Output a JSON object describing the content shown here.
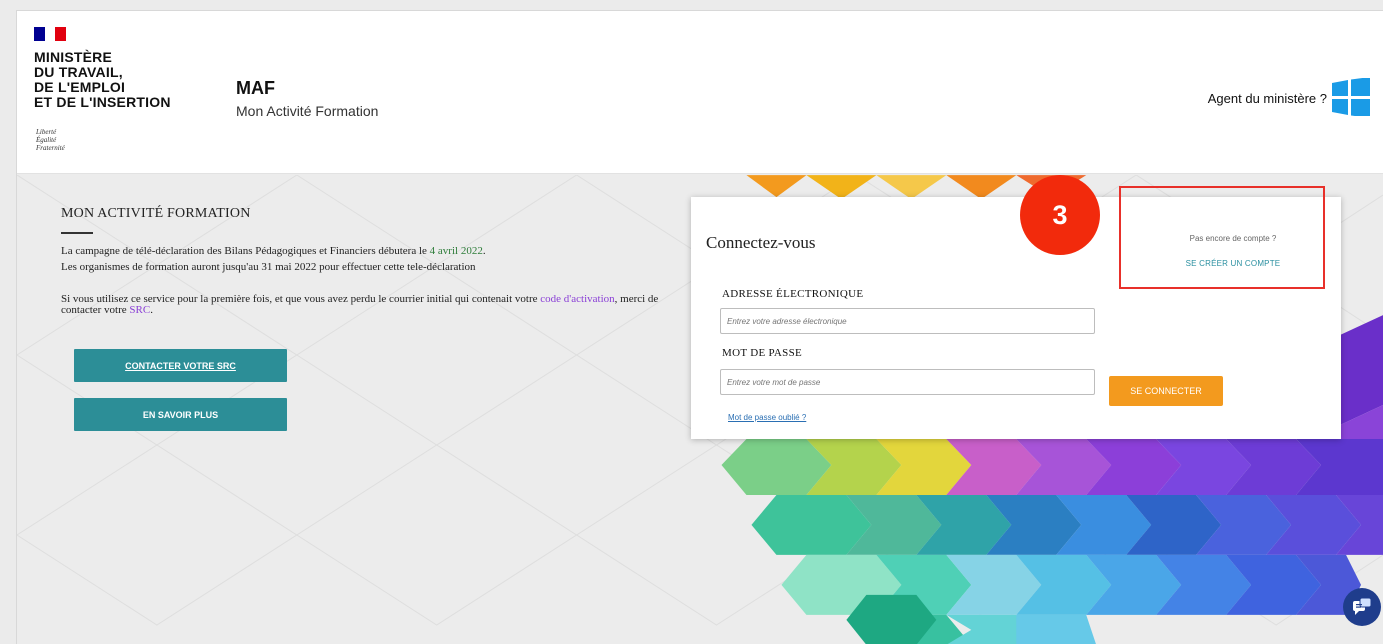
{
  "colors": {
    "flag_blue": "#000091",
    "flag_white": "#ffffff",
    "flag_red": "#e1000f",
    "teal_button": "#2c8e97",
    "orange_button": "#f39a1e",
    "annotation_red": "#f22a0c",
    "link_blue": "#2a6fb3",
    "windows_blue": "#1a9be6",
    "chat_blue": "#1f3d8c"
  },
  "header": {
    "ministry_lines": [
      "MINISTÈRE",
      "DU TRAVAIL,",
      "DE L'EMPLOI",
      "ET DE L'INSERTION"
    ],
    "motto_lines": [
      "Liberté",
      "Égalité",
      "Fraternité"
    ],
    "app_title": "MAF",
    "app_subtitle": "Mon Activité Formation",
    "agent_link": "Agent du ministère ?",
    "agent_icon": "windows-icon"
  },
  "left": {
    "heading": "MON ACTIVITÉ FORMATION",
    "para1_a": "La campagne de télé-déclaration des Bilans Pédagogiques et Financiers débutera le ",
    "para1_date": "4 avril 2022",
    "para1_end": ".",
    "para2": "Les organismes de formation auront jusqu'au 31 mai 2022 pour effectuer cette tele-déclaration",
    "para3_a": "Si vous utilisez ce service pour la première fois, et que vous avez perdu le courrier initial qui contenait votre ",
    "para3_link": "code d'activation",
    "para3_b": ", merci de contacter votre ",
    "para3_src": "SRC",
    "para3_end": ".",
    "contact_button": "CONTACTER VOTRE SRC",
    "more_button": "EN SAVOIR PLUS"
  },
  "login": {
    "title": "Connectez-vous",
    "email_label": "ADRESSE ÉLECTRONIQUE",
    "email_placeholder": "Entrez votre adresse électronique",
    "password_label": "MOT DE PASSE",
    "password_placeholder": "Entrez votre mot de passe",
    "submit": "SE CONNECTER",
    "forgot": "Mot de passe oublié ?",
    "no_account": "Pas encore de compte ?",
    "create_account": "SE CRÉER UN COMPTE"
  },
  "annotation": {
    "badge_number": "3"
  },
  "chat_icon": "chat-icon"
}
